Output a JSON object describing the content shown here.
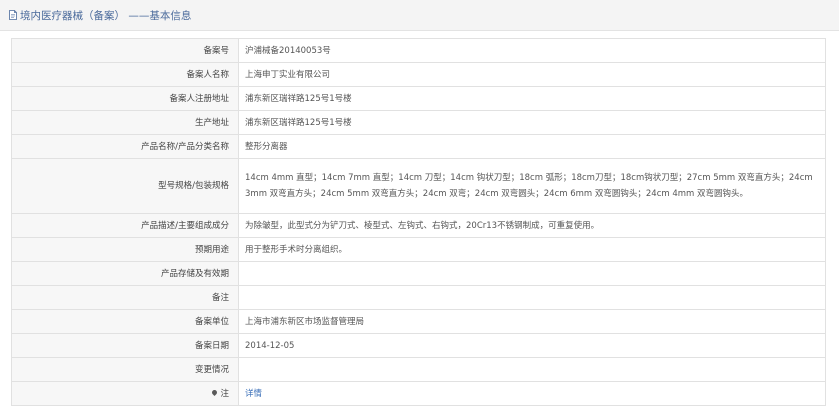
{
  "header": {
    "title": "境内医疗器械（备案） ——基本信息"
  },
  "rows": [
    {
      "label": "备案号",
      "value": "沪浦械备20140053号"
    },
    {
      "label": "备案人名称",
      "value": "上海申丁实业有限公司"
    },
    {
      "label": "备案人注册地址",
      "value": "浦东新区瑞祥路125号1号楼"
    },
    {
      "label": "生产地址",
      "value": "浦东新区瑞祥路125号1号楼"
    },
    {
      "label": "产品名称/产品分类名称",
      "value": "整形分离器"
    },
    {
      "label": "型号规格/包装规格",
      "value": "14cm 4mm 直型；14cm 7mm 直型；14cm 刀型；14cm 钩状刀型；18cm 弧形；18cm刀型；18cm钩状刀型；27cm 5mm 双弯直方头；24cm 3mm 双弯直方头；24cm 5mm 双弯直方头；24cm 双弯；24cm 双弯圆头；24cm 6mm 双弯圆钩头；24cm 4mm 双弯圆钩头。"
    },
    {
      "label": "产品描述/主要组成成分",
      "value": "为除皱型，此型式分为铲刀式、棱型式、左钩式、右钩式，20Cr13不锈钢制成，可重复使用。"
    },
    {
      "label": "预期用途",
      "value": "用于整形手术时分离组织。"
    },
    {
      "label": "产品存储及有效期",
      "value": ""
    },
    {
      "label": "备注",
      "value": ""
    },
    {
      "label": "备案单位",
      "value": "上海市浦东新区市场监督管理局"
    },
    {
      "label": "备案日期",
      "value": "2014-12-05"
    },
    {
      "label": "变更情况",
      "value": ""
    },
    {
      "label": "注",
      "value": "详情"
    }
  ],
  "icons": {
    "header": "document-icon",
    "note": "map-pin-icon"
  },
  "colors": {
    "header_bg": "#f4f4f4",
    "title": "#4a6a9b",
    "label_bg": "#f7f7f7",
    "border": "#e1e1e1",
    "link": "#3a6fb8"
  }
}
